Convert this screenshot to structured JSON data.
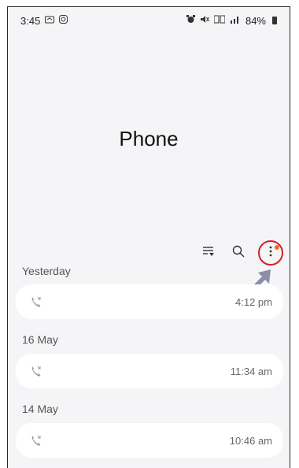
{
  "status_bar": {
    "time": "3:45",
    "battery": "84%"
  },
  "header": {
    "title": "Phone"
  },
  "toolbar": {
    "filter_icon": "filter-icon",
    "search_icon": "search-icon",
    "more_icon": "more-options-icon"
  },
  "call_log": {
    "groups": [
      {
        "label": "Yesterday",
        "items": [
          {
            "time": "4:12 pm",
            "icon": "missed-call-icon"
          }
        ]
      },
      {
        "label": "16 May",
        "items": [
          {
            "time": "11:34 am",
            "icon": "missed-call-icon"
          }
        ]
      },
      {
        "label": "14 May",
        "items": [
          {
            "time": "10:46 am",
            "icon": "missed-call-icon"
          }
        ]
      }
    ]
  },
  "colors": {
    "highlight_circle": "#d61f26",
    "badge_dot": "#f06a2f",
    "pointer_arrow": "#8c8fa6",
    "call_icon": "#9aa0a6"
  }
}
